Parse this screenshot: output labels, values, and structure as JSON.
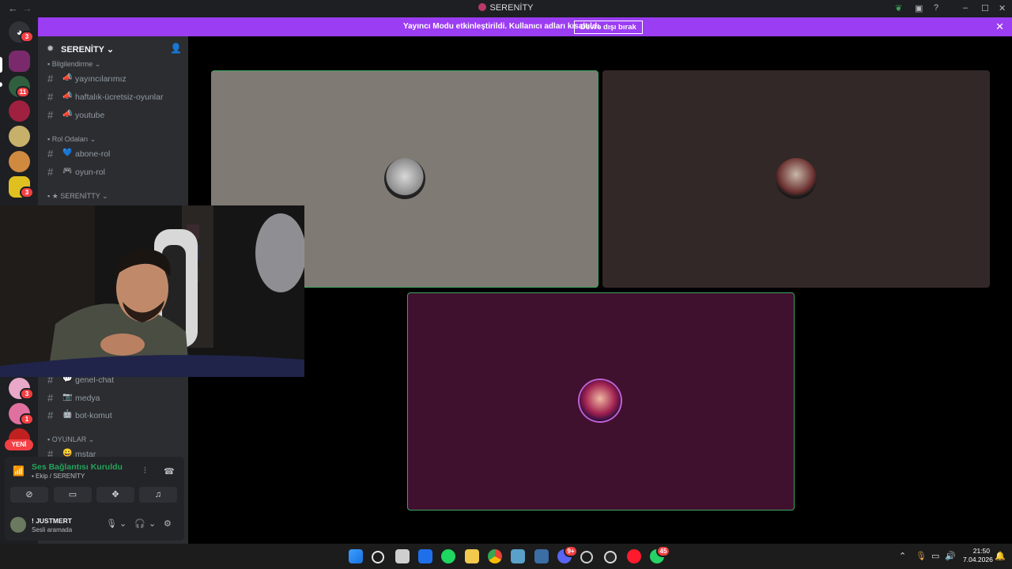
{
  "window": {
    "title": "SERENİTY"
  },
  "banner": {
    "message": "Yayıncı Modu etkinleştirildi. Kullanıcı adları kısaltıldı.",
    "button": "Devre dışı bırak"
  },
  "rail": {
    "badges": [
      "3",
      "11",
      "3",
      "3",
      "1"
    ],
    "new_label": "YENİ"
  },
  "server": {
    "name": "SERENİTY"
  },
  "channels": {
    "cat1": "▪ Bilgilendirme ⌄",
    "c1": "yayıncılarımız",
    "c2": "haftalık-ücretsiz-oyunlar",
    "c3": "youtube",
    "cat2": "▪ Rol Odaları ⌄",
    "c4": "abone-rol",
    "c5": "oyun-rol",
    "cat3": "▪ ★ SERENİTTY ⌄",
    "c6": "genel-chat",
    "c7": "medya",
    "c8": "bot-komut",
    "cat4": "▪ OYUNLAR ⌄",
    "c9": "mstar"
  },
  "voice": {
    "status": "Ses Bağlantısı Kuruldu",
    "channel": "▪ Ekip / SERENİTY"
  },
  "user": {
    "name": "! JUSTMERT",
    "status": "Sesli aramada"
  },
  "taskbar": {
    "discord_badge": "9+",
    "whatsapp_badge": "45",
    "time": "21:50",
    "date": "7.04.2026"
  },
  "colors": {
    "accent": "#9b3df2",
    "connected": "#23a55a",
    "badge": "#f23f43",
    "tile1": "#7f7a74",
    "tile2": "#332828",
    "tile3": "#40102f"
  }
}
